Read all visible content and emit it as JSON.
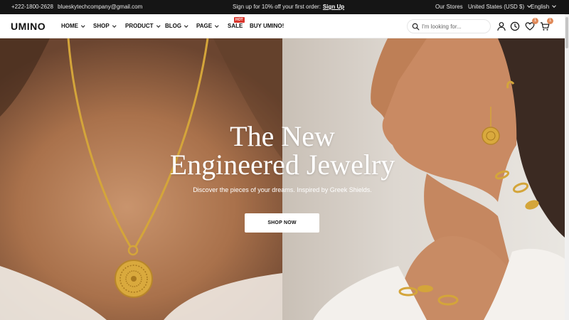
{
  "topbar": {
    "phone": "+222-1800-2628",
    "email": "blueskytechcompany@gmail.com",
    "promo_text": "Sign up for 10% off your first order:",
    "promo_link": "Sign Up",
    "stores": "Our Stores",
    "currency": "United States (USD $)",
    "language": "English"
  },
  "header": {
    "logo": "UMINO",
    "nav": {
      "home": "HOME",
      "shop": "SHOP",
      "product": "PRODUCT",
      "blog": "BLOG",
      "page": "PAGE",
      "sale": "SALE",
      "buy": "BUY UMINO!"
    },
    "hot_badge": "HOT",
    "search_placeholder": "I'm looking for...",
    "wishlist_count": "1",
    "cart_count": "1"
  },
  "hero": {
    "title_line1": "The New",
    "title_line2": "Engineered Jewelry",
    "subtitle": "Discover the pieces of your dreams. Inspired by Greek Shields.",
    "button": "SHOP NOW"
  },
  "colors": {
    "topbar_bg": "#151515",
    "badge": "#d9342b",
    "counter": "#e08a5a",
    "gold": "#d4a53a"
  }
}
